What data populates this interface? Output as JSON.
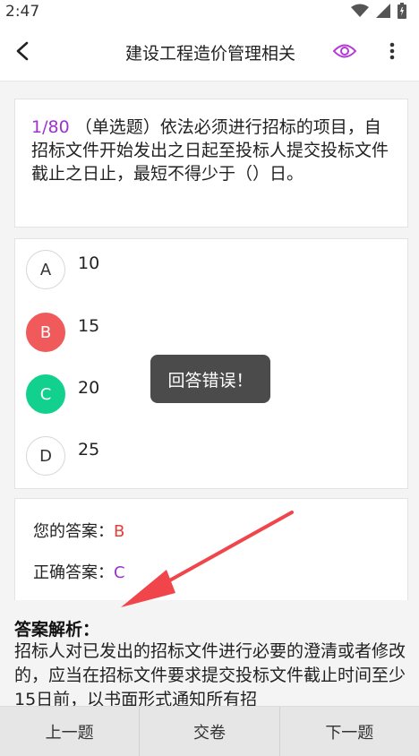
{
  "status": {
    "time": "2:47",
    "icons": [
      "wifi-icon",
      "signal-icon",
      "battery-icon"
    ]
  },
  "header": {
    "title": "建设工程造价管理相关",
    "back_icon": "chevron-left-icon",
    "eye_icon": "eye-icon",
    "more_icon": "more-vertical-icon"
  },
  "question": {
    "number": "1/80",
    "text": " （单选题）依法必须进行招标的项目，自招标文件开始发出之日起至投标人提交投标文件截止之日止，最短不得少于（）日。"
  },
  "options": [
    {
      "letter": "A",
      "value": "10",
      "state": "normal"
    },
    {
      "letter": "B",
      "value": "15",
      "state": "wrong"
    },
    {
      "letter": "C",
      "value": "20",
      "state": "right"
    },
    {
      "letter": "D",
      "value": "25",
      "state": "normal"
    }
  ],
  "toast": {
    "text": "回答错误！"
  },
  "answer": {
    "your_label": "您的答案：",
    "your_value": "B",
    "correct_label": "正确答案：",
    "correct_value": "C"
  },
  "analysis": {
    "title": "答案解析：",
    "text": "招标人对已发出的招标文件进行必要的澄清或者修改的，应当在招标文件要求提交投标文件截止时间至少15日前，以书面形式通知所有招"
  },
  "bottom": {
    "prev": "上一题",
    "submit": "交卷",
    "next": "下一题"
  },
  "colors": {
    "accent": "#9b33cc",
    "wrong": "#f05a5a",
    "right": "#12d18e",
    "annotation": "#f0464b"
  }
}
